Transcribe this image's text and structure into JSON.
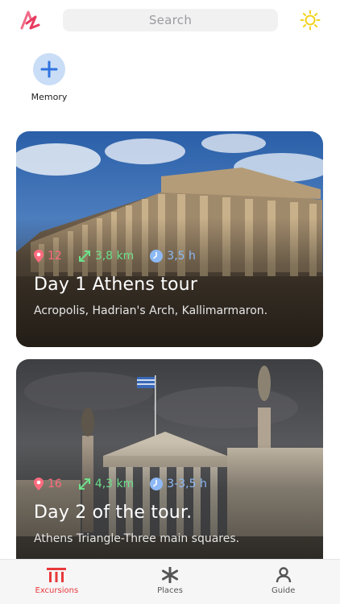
{
  "header": {
    "logo_icon": "app-logo",
    "search_placeholder": "Search",
    "theme_icon": "sun-icon"
  },
  "memory": {
    "label": "Memory",
    "icon": "plus-icon"
  },
  "tours": [
    {
      "places": "12",
      "distance": "3,8 km",
      "duration": "3,5 h",
      "title": "Day 1 Athens tour",
      "subtitle": "Acropolis, Hadrian's Arch, Kallimarmaron."
    },
    {
      "places": "16",
      "distance": "4,3 km",
      "duration": "3-3,5 h",
      "title": "Day 2 of the tour.",
      "subtitle": "Athens Triangle-Three main squares."
    }
  ],
  "tabbar": {
    "tabs": [
      {
        "label": "Excursions",
        "icon": "columns-icon",
        "active": true
      },
      {
        "label": "Places",
        "icon": "asterisk-icon",
        "active": false
      },
      {
        "label": "Guide",
        "icon": "person-icon",
        "active": false
      }
    ]
  },
  "colors": {
    "accent": "#e8393a",
    "pin": "#ff6b7e",
    "distance": "#6ce08a",
    "time": "#8db9f5",
    "memory_button": "#c9ddf7",
    "sun": "#f2d31b"
  }
}
